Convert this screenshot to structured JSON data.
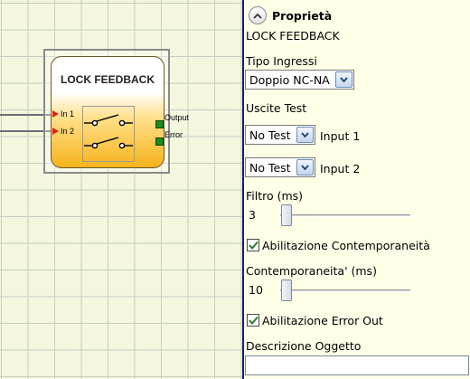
{
  "canvas": {
    "block": {
      "title": "LOCK FEEDBACK",
      "inputs": [
        "In 1",
        "In 2"
      ],
      "outputs": [
        "Output",
        "Error"
      ]
    }
  },
  "properties": {
    "heading": "Proprietà",
    "object_name": "LOCK FEEDBACK",
    "input_type": {
      "label": "Tipo Ingressi",
      "value": "Doppio NC-NA"
    },
    "test_outputs": {
      "label": "Uscite Test",
      "rows": [
        {
          "value": "No Test",
          "label": "Input 1"
        },
        {
          "value": "No Test",
          "label": "Input 2"
        }
      ]
    },
    "filter": {
      "label": "Filtro (ms)",
      "value": "3",
      "level": 0
    },
    "simultaneity_enable": {
      "label": "Abilitazione Contemporaneità",
      "checked": true
    },
    "simultaneity": {
      "label": "Contemporaneita' (ms)",
      "value": "10",
      "level": 0
    },
    "error_out_enable": {
      "label": "Abilitazione Error Out",
      "checked": true
    },
    "description": {
      "label": "Descrizione Oggetto",
      "value": ""
    }
  },
  "colors": {
    "panel_background": "#fffee6",
    "canvas_background": "#f4f6de",
    "divider": "#1a1a80",
    "input_pin": "#e0201a",
    "output_pin": "#1c8a1c"
  },
  "icons": {
    "collapse": "chevron-up-icon",
    "combo": "chevron-down-icon",
    "check": "check-icon"
  }
}
